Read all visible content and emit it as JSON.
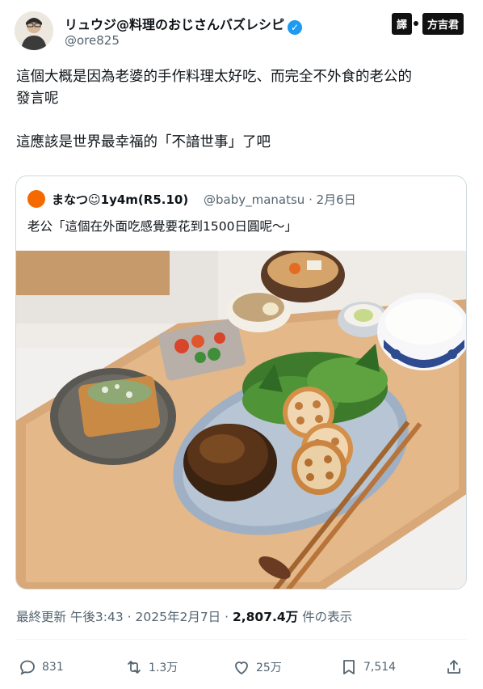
{
  "author": {
    "name": "リュウジ@料理のおじさんバズレシピ",
    "handle": "@ore825",
    "verified_symbol": "✓"
  },
  "translator_badge": {
    "left": "譯",
    "right": "方吉君"
  },
  "tweet": {
    "text": "這個大概是因為老婆的手作料理太好吃、而完全不外食的老公的\n發言呢\n\n這應該是世界最幸福的「不諳世事」了吧"
  },
  "quote": {
    "author_name": "まなつ☺1y4m(R5.10)",
    "meta": "@baby_manatsu · 2月6日",
    "text": "老公「這個在外面吃感覺要花到1500日圓呢～」"
  },
  "timestamp": {
    "time": "最終更新 午後3:43 · 2025年2月7日 · ",
    "views": "2,807.4万",
    "views_suffix": " 件の表示"
  },
  "actions": {
    "reply_count": "831",
    "repost_count": "1.3万",
    "like_count": "25万",
    "bookmark_count": "7,514"
  },
  "colors": {
    "accent": "#1d9bf0",
    "text": "#0f1419",
    "secondary": "#536471",
    "border": "#cfd9de"
  }
}
